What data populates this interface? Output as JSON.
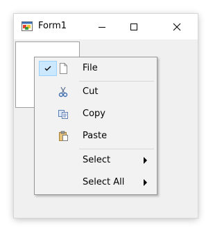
{
  "window": {
    "title": "Form1",
    "app_icon": "winforms-app-icon",
    "controls": {
      "minimize_icon": "minimize-icon",
      "maximize_icon": "maximize-icon",
      "close_icon": "close-icon"
    }
  },
  "context_menu": {
    "items": [
      {
        "label": "File",
        "icon": "document-icon",
        "checked": true
      },
      {
        "label": "Cut",
        "icon": "scissors-icon"
      },
      {
        "label": "Copy",
        "icon": "copy-icon"
      },
      {
        "label": "Paste",
        "icon": "clipboard-icon"
      },
      {
        "label": "Select",
        "has_submenu": true
      },
      {
        "label": "Select All",
        "has_submenu": true
      }
    ]
  }
}
